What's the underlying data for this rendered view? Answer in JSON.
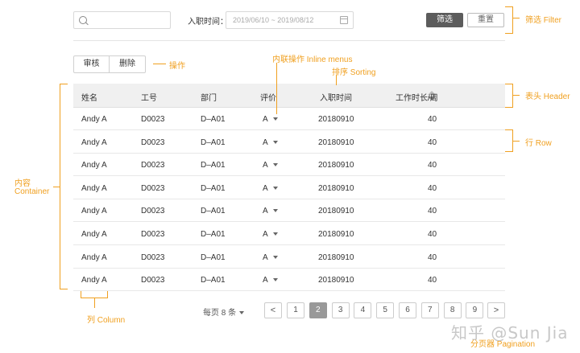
{
  "filter": {
    "search_placeholder": "",
    "date_label": "入职时间：",
    "date_range": "2019/06/10 ~ 2019/08/12",
    "filter_button": "筛选",
    "reset_button": "重置"
  },
  "actions": {
    "approve": "审核",
    "delete": "删除"
  },
  "table": {
    "headers": [
      "姓名",
      "工号",
      "部门",
      "评价",
      "入职时间",
      "工作时长/周"
    ],
    "rows": [
      [
        "Andy A",
        "D0023",
        "D–A01",
        "A",
        "20180910",
        "40"
      ],
      [
        "Andy A",
        "D0023",
        "D–A01",
        "A",
        "20180910",
        "40"
      ],
      [
        "Andy A",
        "D0023",
        "D–A01",
        "A",
        "20180910",
        "40"
      ],
      [
        "Andy A",
        "D0023",
        "D–A01",
        "A",
        "20180910",
        "40"
      ],
      [
        "Andy A",
        "D0023",
        "D–A01",
        "A",
        "20180910",
        "40"
      ],
      [
        "Andy A",
        "D0023",
        "D–A01",
        "A",
        "20180910",
        "40"
      ],
      [
        "Andy A",
        "D0023",
        "D–A01",
        "A",
        "20180910",
        "40"
      ],
      [
        "Andy A",
        "D0023",
        "D–A01",
        "A",
        "20180910",
        "40"
      ]
    ]
  },
  "pagination": {
    "page_size": "每页 8 条",
    "prev": "<",
    "next": ">",
    "pages": [
      "1",
      "2",
      "3",
      "4",
      "5",
      "6",
      "7",
      "8",
      "9"
    ],
    "current": "2"
  },
  "annotations": {
    "filter": "筛选 Filter",
    "action": "操作",
    "inline_menus": "内联操作 Inline menus",
    "sorting": "排序 Sorting",
    "header": "表头 Header",
    "row": "行 Row",
    "container_cn": "内容",
    "container_en": "Container",
    "column": "列 Column",
    "pagination": "分页器 Pagination"
  },
  "watermark": "知乎 @Sun Jia",
  "colors": {
    "annotation": "#f0a020",
    "primary_button": "#5c5c5c",
    "active_page": "#999999",
    "header_bg": "#f0f0f0"
  }
}
